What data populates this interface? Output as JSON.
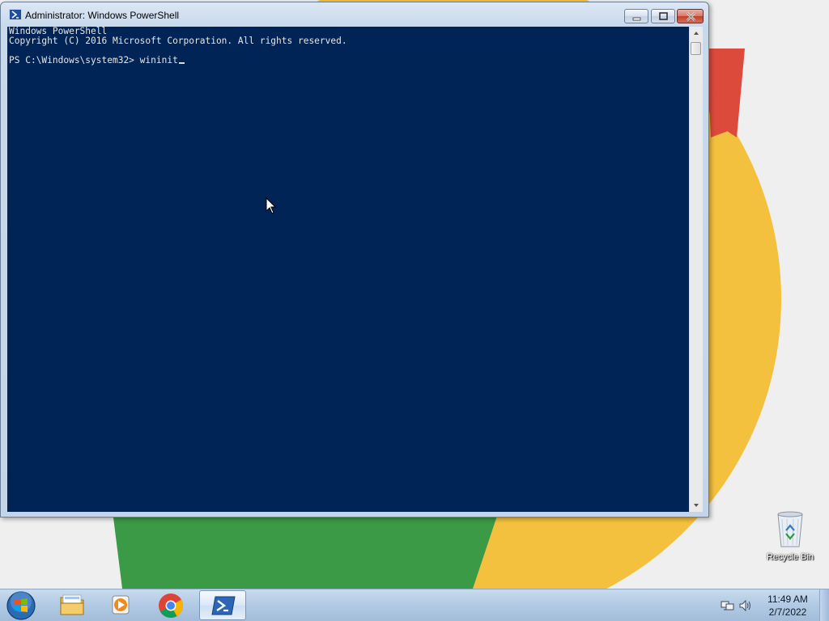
{
  "window": {
    "title": "Administrator: Windows PowerShell"
  },
  "console": {
    "lines": [
      "Windows PowerShell",
      "Copyright (C) 2016 Microsoft Corporation. All rights reserved.",
      "",
      "PS C:\\Windows\\system32> wininit"
    ]
  },
  "desktop": {
    "recycle_bin_label": "Recycle Bin"
  },
  "taskbar": {
    "items": [
      {
        "name": "start-orb-icon"
      },
      {
        "name": "file-explorer-icon"
      },
      {
        "name": "media-player-icon"
      },
      {
        "name": "chrome-icon"
      },
      {
        "name": "powershell-icon",
        "active": true
      }
    ]
  },
  "clock": {
    "time": "11:49 AM",
    "date": "2/7/2022"
  },
  "colors": {
    "console_background": "#012456",
    "console_text": "#e6e6e6"
  }
}
